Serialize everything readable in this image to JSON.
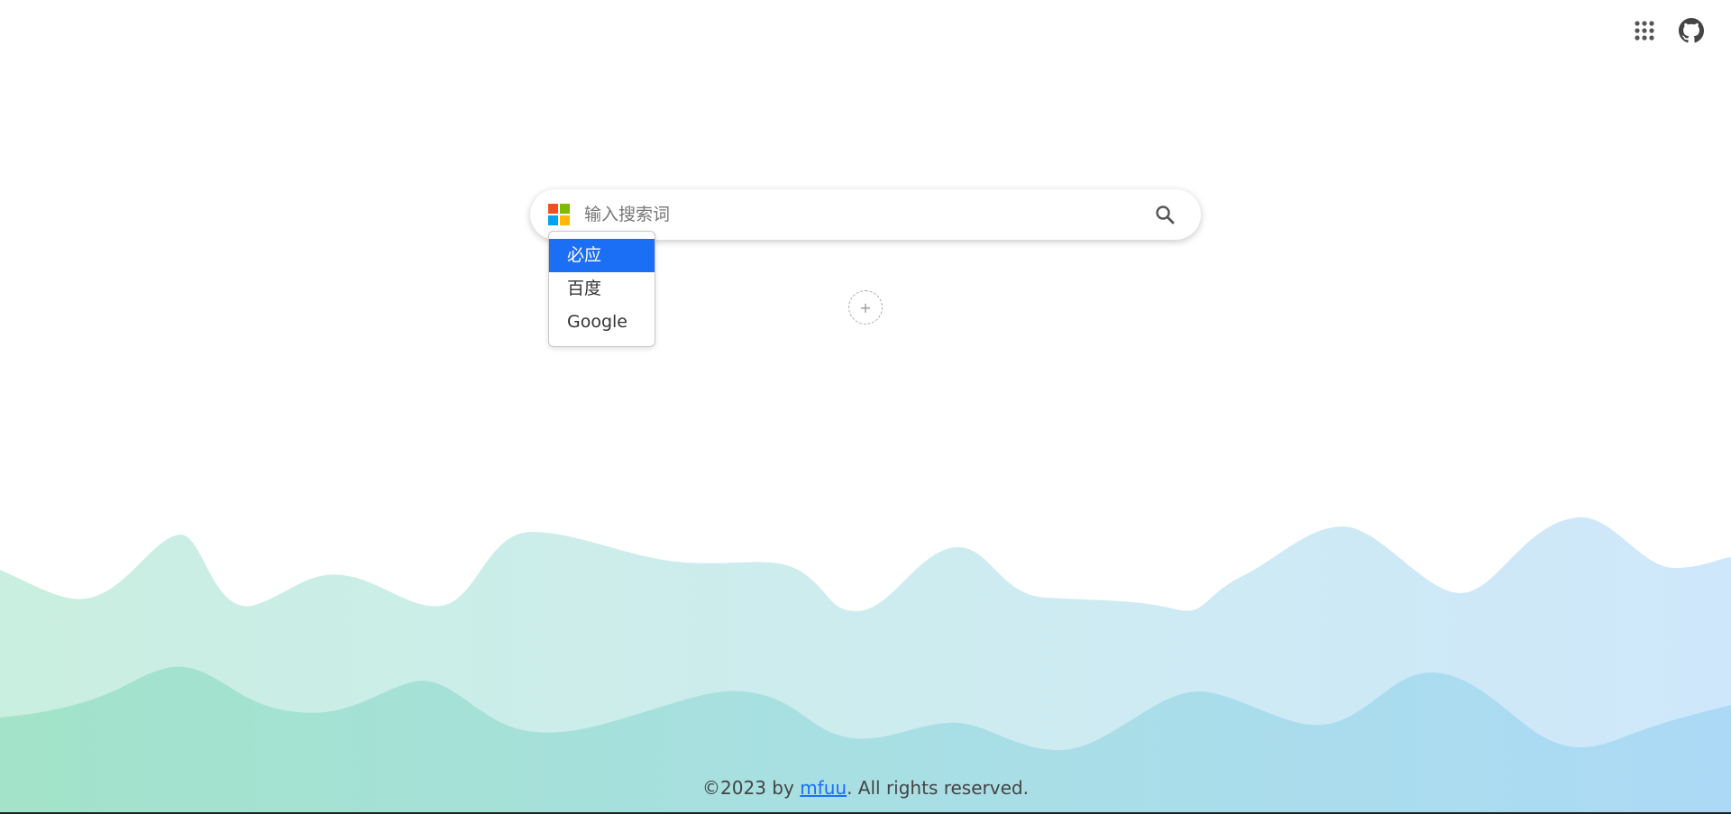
{
  "header": {
    "apps_icon": "apps-grid-icon",
    "github_icon": "github-icon"
  },
  "search": {
    "placeholder": "输入搜索词",
    "value": "",
    "engine_logo_colors": [
      "#f25022",
      "#7fba00",
      "#00a4ef",
      "#ffb900"
    ],
    "search_icon": "search-icon"
  },
  "engine_dropdown": {
    "options": [
      {
        "label": "必应",
        "selected": true
      },
      {
        "label": "百度",
        "selected": false
      },
      {
        "label": "Google",
        "selected": false
      }
    ],
    "accent_color": "#1a6ff5"
  },
  "shortcuts": {
    "add_label": "+"
  },
  "footer": {
    "prefix": "©2023 by ",
    "link_text": "mfuu",
    "suffix": ". All rights reserved."
  }
}
